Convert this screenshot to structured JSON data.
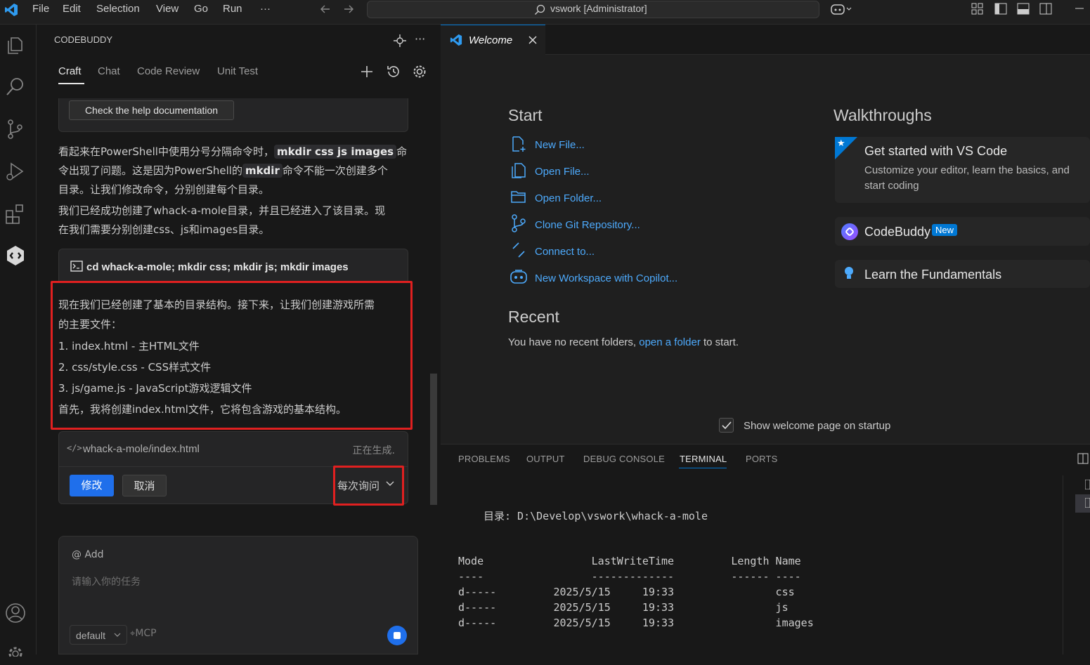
{
  "menu": {
    "items": [
      "File",
      "Edit",
      "Selection",
      "View",
      "Go",
      "Run"
    ],
    "more": "···"
  },
  "command_center": {
    "text": "vswork [Administrator]"
  },
  "sidebar": {
    "title": "CODEBUDDY",
    "tabs": [
      "Craft",
      "Chat",
      "Code Review",
      "Unit Test"
    ],
    "help_button": "Check the help documentation",
    "msg1": {
      "t1": "看起来在PowerShell中使用分号分隔命令时，",
      "c1": "mkdir css js images",
      "t2": "命",
      "t3": "令出现了问题。这是因为PowerShell的",
      "c2": "mkdir",
      "t4": "命令不能一次创建多个",
      "t5": "目录。让我们修改命令，分别创建每个目录。"
    },
    "msg2": {
      "l1": "我们已经成功创建了whack-a-mole目录，并且已经进入了该目录。现",
      "l2": "在我们需要分别创建css、js和images目录。"
    },
    "command": "cd whack-a-mole; mkdir css; mkdir js; mkdir images",
    "highlight": {
      "l1": "现在我们已经创建了基本的目录结构。接下来，让我们创建游戏所需",
      "l2": "的主要文件：",
      "i1": "1. index.html - 主HTML文件",
      "i2": "2. css/style.css - CSS样式文件",
      "i3": "3. js/game.js - JavaScript游戏逻辑文件",
      "l3": "首先，我将创建index.html文件，它将包含游戏的基本结构。"
    },
    "file_card": {
      "path": "whack-a-mole/index.html",
      "status": "正在生成.",
      "modify": "修改",
      "cancel": "取消",
      "mode": "每次询问"
    },
    "input": {
      "add": "@ Add",
      "placeholder": "请输入你的任务",
      "model": "default",
      "mcp": "MCP"
    }
  },
  "editor": {
    "tab": "Welcome",
    "start_heading": "Start",
    "start_items": [
      "New File...",
      "Open File...",
      "Open Folder...",
      "Clone Git Repository...",
      "Connect to...",
      "New Workspace with Copilot..."
    ],
    "recent_heading": "Recent",
    "recent_pre": "You have no recent folders,",
    "recent_link": "open a folder",
    "recent_post": "to start.",
    "walkthroughs_heading": "Walkthroughs",
    "wt1_title": "Get started with VS Code",
    "wt1_desc1": "Customize your editor, learn the basics, and",
    "wt1_desc2": "start coding",
    "wt2_title": "CodeBuddy",
    "wt2_badge": "New",
    "wt3_title": "Learn the Fundamentals",
    "show_welcome": "Show welcome page on startup"
  },
  "panel": {
    "tabs": [
      "PROBLEMS",
      "OUTPUT",
      "DEBUG CONSOLE",
      "TERMINAL",
      "PORTS"
    ],
    "active_tab": "TERMINAL",
    "dir_line": "目录: D:\\Develop\\vswork\\whack-a-mole",
    "header": "Mode                 LastWriteTime         Length Name",
    "sep": "----                 -------------         ------ ----",
    "rows": [
      "d-----         2025/5/15     19:33                css",
      "d-----         2025/5/15     19:33                js",
      "d-----         2025/5/15     19:33                images"
    ]
  },
  "colors": {
    "accent": "#0078d4",
    "link": "#4daafc",
    "highlight_border": "#e02020",
    "primary_button": "#1f6feb"
  }
}
